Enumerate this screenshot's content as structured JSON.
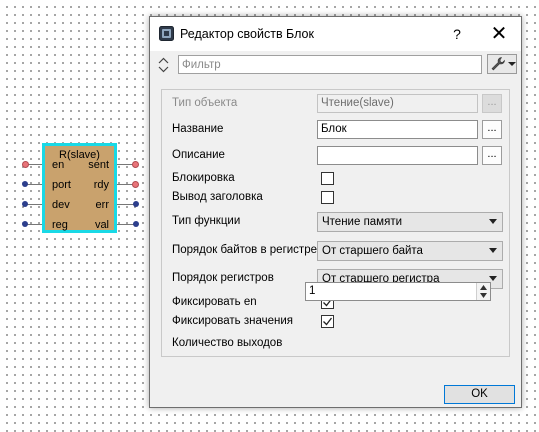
{
  "canvas": {
    "block": {
      "title": "R(slave)",
      "left_ports": [
        "en",
        "port",
        "dev",
        "reg"
      ],
      "right_ports": [
        "sent",
        "rdy",
        "err",
        "val"
      ],
      "fill_color": "#c9a26d",
      "selection_color": "#19d9e6"
    }
  },
  "dialog": {
    "title": "Редактор свойств Блок",
    "help_label": "?",
    "close_label": "✕",
    "filter": {
      "placeholder": "Фильтр",
      "value": ""
    },
    "properties": {
      "object_type": {
        "label": "Тип объекта",
        "value": "Чтение(slave)",
        "browse": "..."
      },
      "name": {
        "label": "Название",
        "value": "Блок",
        "browse": "..."
      },
      "description": {
        "label": "Описание",
        "value": "",
        "browse": "..."
      },
      "lock": {
        "label": "Блокировка",
        "checked": false
      },
      "show_title": {
        "label": "Вывод заголовка",
        "checked": false
      },
      "function_type": {
        "label": "Тип функции",
        "value": "Чтение памяти"
      },
      "byte_order": {
        "label": "Порядок байтов в регистре",
        "value": "От старшего байта"
      },
      "register_order": {
        "label": "Порядок регистров",
        "value": "От старшего регистра"
      },
      "fix_en": {
        "label": "Фиксировать en",
        "checked": true
      },
      "fix_values": {
        "label": "Фиксировать значения",
        "checked": true
      },
      "output_count": {
        "label": "Количество выходов",
        "value": "1"
      }
    },
    "ok_label": "OK",
    "accent_color": "#0078d7"
  }
}
